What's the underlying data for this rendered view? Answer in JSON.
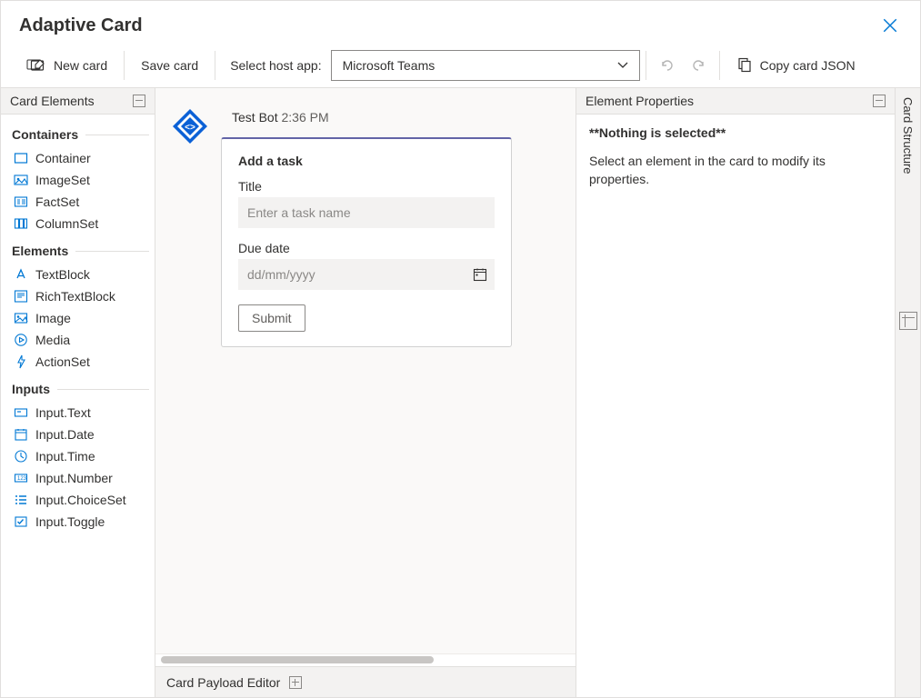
{
  "title": "Adaptive Card",
  "toolbar": {
    "new_card": "New card",
    "save_card": "Save card",
    "host_label": "Select host app:",
    "host_selected": "Microsoft Teams",
    "copy_json": "Copy card JSON"
  },
  "left_panel": {
    "title": "Card Elements",
    "groups": {
      "containers": {
        "title": "Containers",
        "items": [
          "Container",
          "ImageSet",
          "FactSet",
          "ColumnSet"
        ]
      },
      "elements": {
        "title": "Elements",
        "items": [
          "TextBlock",
          "RichTextBlock",
          "Image",
          "Media",
          "ActionSet"
        ]
      },
      "inputs": {
        "title": "Inputs",
        "items": [
          "Input.Text",
          "Input.Date",
          "Input.Time",
          "Input.Number",
          "Input.ChoiceSet",
          "Input.Toggle"
        ]
      }
    }
  },
  "canvas": {
    "bot_name": "Test Bot",
    "bot_time": "2:36 PM",
    "card": {
      "heading": "Add a task",
      "title_label": "Title",
      "title_placeholder": "Enter a task name",
      "due_label": "Due date",
      "due_placeholder": "dd/mm/yyyy",
      "submit": "Submit"
    }
  },
  "right_panel": {
    "title": "Element Properties",
    "nothing": "**Nothing is selected**",
    "instruction": "Select an element in the card to modify its properties."
  },
  "rail": {
    "structure": "Card Structure"
  },
  "footer": {
    "payload_editor": "Card Payload Editor"
  }
}
